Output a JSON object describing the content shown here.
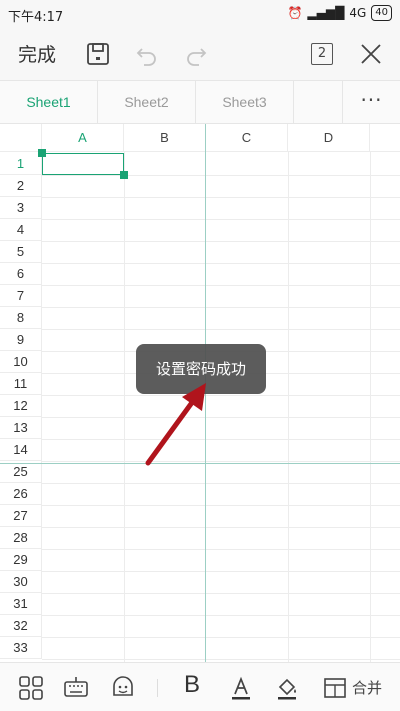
{
  "status_bar": {
    "time": "下午4:17",
    "network": "4G",
    "battery": "40"
  },
  "toolbar": {
    "done_label": "完成",
    "window_count": "2",
    "icons": [
      "save-icon",
      "undo-icon",
      "redo-icon",
      "window-count-icon",
      "close-icon"
    ]
  },
  "sheet_tabs": {
    "tabs": [
      {
        "label": "Sheet1",
        "active": true
      },
      {
        "label": "Sheet2",
        "active": false
      },
      {
        "label": "Sheet3",
        "active": false
      }
    ],
    "more_label": "···"
  },
  "grid": {
    "columns": [
      "A",
      "B",
      "C",
      "D"
    ],
    "active_column": "A",
    "rows": [
      "1",
      "2",
      "3",
      "4",
      "5",
      "6",
      "7",
      "8",
      "9",
      "10",
      "11",
      "12",
      "13",
      "14",
      "25",
      "26",
      "27",
      "28",
      "29",
      "30",
      "31",
      "32",
      "33"
    ],
    "active_row": "1",
    "selected_cell": "A1"
  },
  "toast": {
    "message": "设置密码成功"
  },
  "bottom_toolbar": {
    "icons": [
      "grid-apps-icon",
      "keyboard-icon",
      "emoji-icon",
      "bold-icon",
      "font-color-icon",
      "fill-color-icon",
      "merge-cells-icon"
    ],
    "bold_label": "B",
    "merge_label": "合并"
  },
  "colors": {
    "accent": "#1aa374",
    "toast_bg": "#505050",
    "arrow": "#b0141c"
  }
}
